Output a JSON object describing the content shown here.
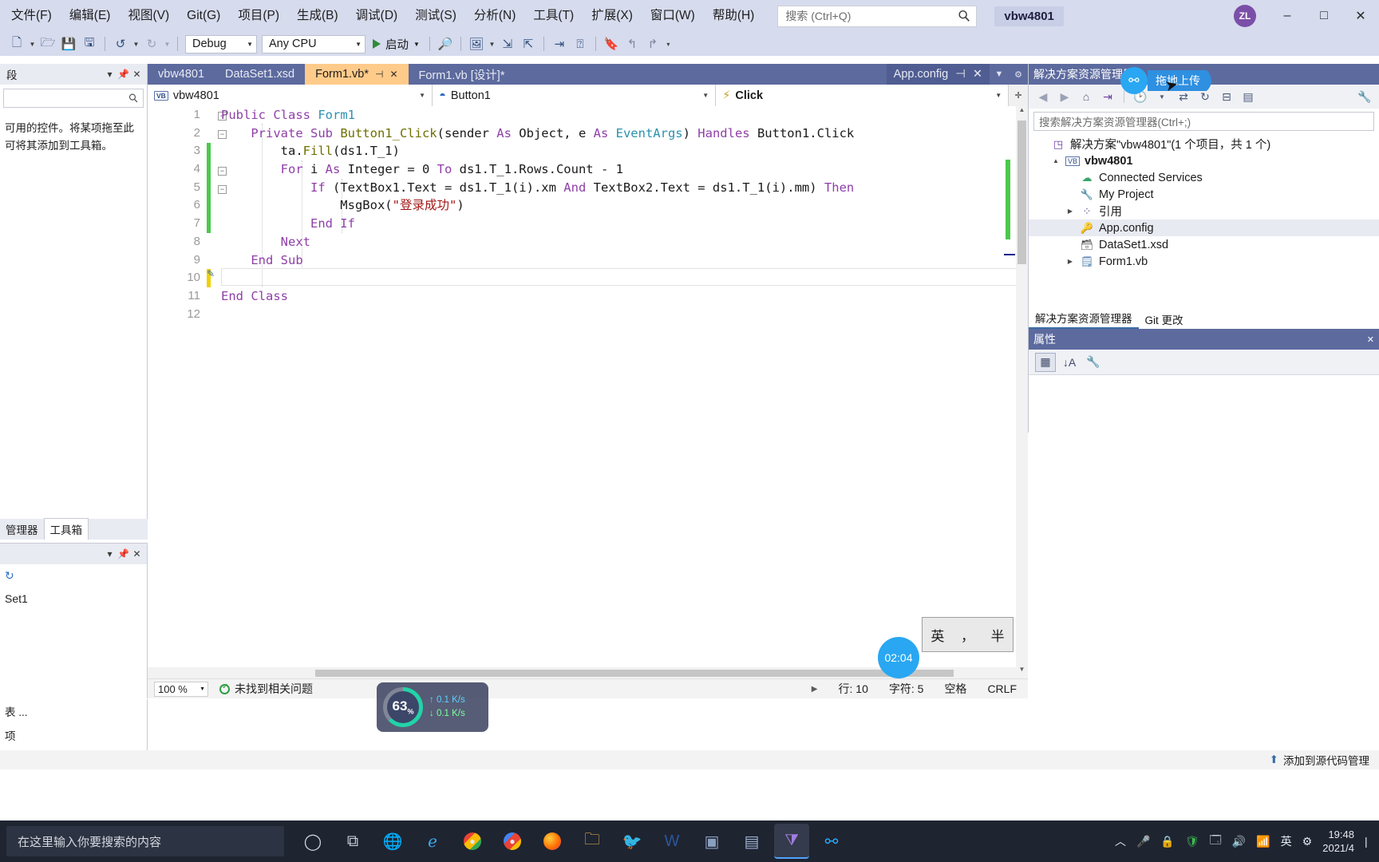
{
  "menu": {
    "items": [
      "文件(F)",
      "编辑(E)",
      "视图(V)",
      "Git(G)",
      "项目(P)",
      "生成(B)",
      "调试(D)",
      "测试(S)",
      "分析(N)",
      "工具(T)",
      "扩展(X)",
      "窗口(W)",
      "帮助(H)"
    ],
    "search_placeholder": "搜索 (Ctrl+Q)",
    "project_chip": "vbw4801",
    "avatar_initials": "ZL",
    "minimize": "–",
    "maximize": "□",
    "close": "✕"
  },
  "toolbar": {
    "config": "Debug",
    "platform": "Any CPU",
    "run_label": "启动",
    "live_share": "Live Share"
  },
  "left_panel": {
    "title_fragment": "段",
    "search_placeholder": "",
    "hint_line1": "可用的控件。将某项拖至此",
    "hint_line2": "可将其添加到工具箱。",
    "tabs": [
      "管理器",
      "工具箱"
    ],
    "active_tab": "工具箱",
    "datasource_item": "Set1",
    "strip_line1": "表 ...",
    "strip_line2": "项"
  },
  "doc_tabs": {
    "items": [
      {
        "label": "vbw4801",
        "active": false,
        "closable": false
      },
      {
        "label": "DataSet1.xsd",
        "active": false,
        "closable": false
      },
      {
        "label": "Form1.vb*",
        "active": true,
        "closable": true
      },
      {
        "label": "Form1.vb [设计]*",
        "active": false,
        "closable": false
      }
    ],
    "right_tab": "App.config"
  },
  "nav_bar": {
    "project": "vbw4801",
    "member": "Button1",
    "event": "Click",
    "project_badge": "VB"
  },
  "code": {
    "lines": [
      {
        "n": 1,
        "segments": [
          {
            "t": "Public Class ",
            "c": "kw"
          },
          {
            "t": "Form1",
            "c": "typ"
          }
        ]
      },
      {
        "n": 2,
        "segments": [
          {
            "t": "    Private Sub ",
            "c": "kw"
          },
          {
            "t": "Button1_Click",
            "c": "fn"
          },
          {
            "t": "(sender ",
            "c": "pl"
          },
          {
            "t": "As ",
            "c": "kw"
          },
          {
            "t": "Object, e ",
            "c": "pl"
          },
          {
            "t": "As ",
            "c": "kw"
          },
          {
            "t": "EventArgs",
            "c": "typ"
          },
          {
            "t": ") ",
            "c": "pl"
          },
          {
            "t": "Handles ",
            "c": "kw"
          },
          {
            "t": "Button1.Click",
            "c": "pl"
          }
        ]
      },
      {
        "n": 3,
        "segments": [
          {
            "t": "        ta.",
            "c": "pl"
          },
          {
            "t": "Fill",
            "c": "fn"
          },
          {
            "t": "(ds1.T_1)",
            "c": "pl"
          }
        ]
      },
      {
        "n": 4,
        "segments": [
          {
            "t": "        For ",
            "c": "kw"
          },
          {
            "t": "i ",
            "c": "pl"
          },
          {
            "t": "As ",
            "c": "kw"
          },
          {
            "t": "Integer ",
            "c": "pl"
          },
          {
            "t": "= 0 ",
            "c": "pl"
          },
          {
            "t": "To ",
            "c": "kw"
          },
          {
            "t": "ds1.T_1.Rows.Count - 1",
            "c": "pl"
          }
        ]
      },
      {
        "n": 5,
        "segments": [
          {
            "t": "            If ",
            "c": "kw"
          },
          {
            "t": "(TextBox1.Text = ds1.T_1(i).xm ",
            "c": "pl"
          },
          {
            "t": "And ",
            "c": "kw"
          },
          {
            "t": "TextBox2.Text = ds1.T_1(i).mm) ",
            "c": "pl"
          },
          {
            "t": "Then",
            "c": "kw"
          }
        ]
      },
      {
        "n": 6,
        "segments": [
          {
            "t": "                MsgBox(",
            "c": "pl"
          },
          {
            "t": "\"登录成功\"",
            "c": "str"
          },
          {
            "t": ")",
            "c": "pl"
          }
        ]
      },
      {
        "n": 7,
        "segments": [
          {
            "t": "            End If",
            "c": "kw"
          }
        ]
      },
      {
        "n": 8,
        "segments": [
          {
            "t": "        Next",
            "c": "kw"
          }
        ]
      },
      {
        "n": 9,
        "segments": [
          {
            "t": "    End Sub",
            "c": "kw"
          }
        ]
      },
      {
        "n": 10,
        "segments": [
          {
            "t": "",
            "c": "pl"
          }
        ]
      },
      {
        "n": 11,
        "segments": [
          {
            "t": "End Class",
            "c": "kw"
          }
        ]
      },
      {
        "n": 12,
        "segments": [
          {
            "t": "",
            "c": "pl"
          }
        ]
      }
    ]
  },
  "editor_status": {
    "zoom": "100 %",
    "issues": "未找到相关问题",
    "line": "行: 10",
    "col": "字符: 5",
    "spaces": "空格",
    "eol": "CRLF"
  },
  "solution_explorer": {
    "title": "解决方案资源管理器",
    "search_placeholder": "搜索解决方案资源管理器(Ctrl+;)",
    "tree": [
      {
        "label": "解决方案\"vbw4801\"(1 个项目，共 1 个)",
        "depth": 0,
        "arrow": "",
        "glyph": "sln-icon",
        "bold": false,
        "selected": false
      },
      {
        "label": "vbw4801",
        "depth": 1,
        "arrow": "▲",
        "glyph": "vb-project-icon",
        "bold": true,
        "selected": false
      },
      {
        "label": "Connected Services",
        "depth": 2,
        "arrow": "",
        "glyph": "cloud-icon",
        "bold": false,
        "selected": false
      },
      {
        "label": "My Project",
        "depth": 2,
        "arrow": "",
        "glyph": "wrench-icon",
        "bold": false,
        "selected": false
      },
      {
        "label": "引用",
        "depth": 2,
        "arrow": "▶",
        "glyph": "references-icon",
        "bold": false,
        "selected": false
      },
      {
        "label": "App.config",
        "depth": 2,
        "arrow": "",
        "glyph": "config-icon",
        "bold": false,
        "selected": true
      },
      {
        "label": "DataSet1.xsd",
        "depth": 2,
        "arrow": "",
        "glyph": "dataset-icon",
        "bold": false,
        "selected": false
      },
      {
        "label": "Form1.vb",
        "depth": 2,
        "arrow": "▶",
        "glyph": "form-icon",
        "bold": false,
        "selected": false
      }
    ],
    "tabs": [
      "解决方案资源管理器",
      "Git 更改"
    ],
    "active_tab": "解决方案资源管理器"
  },
  "properties": {
    "title": "属性"
  },
  "upload_badge": {
    "label": "拖地上传"
  },
  "vs_bottom": {
    "source_control": "添加到源代码管理"
  },
  "net_widget": {
    "percent": "63",
    "percent_unit": "%",
    "up": "0.1 K/s",
    "down": "0.1 K/s"
  },
  "ime": {
    "mode": "英",
    "punct": "，",
    "shape": "半"
  },
  "clock_bubble": {
    "time": "02:04"
  },
  "taskbar": {
    "search_placeholder": "在这里输入你要搜索的内容",
    "clock_time": "19:48",
    "clock_date": "2021/4",
    "ime_label": "英"
  },
  "colors": {
    "menubar_bg": "#d6dbed",
    "dock_bg": "#5c6a9e",
    "active_tab_bg": "#ffcb8a",
    "accent_blue": "#29a7f2",
    "change_green": "#4bc94b",
    "change_yellow": "#f0d000",
    "taskbar_bg": "#1f2431"
  }
}
